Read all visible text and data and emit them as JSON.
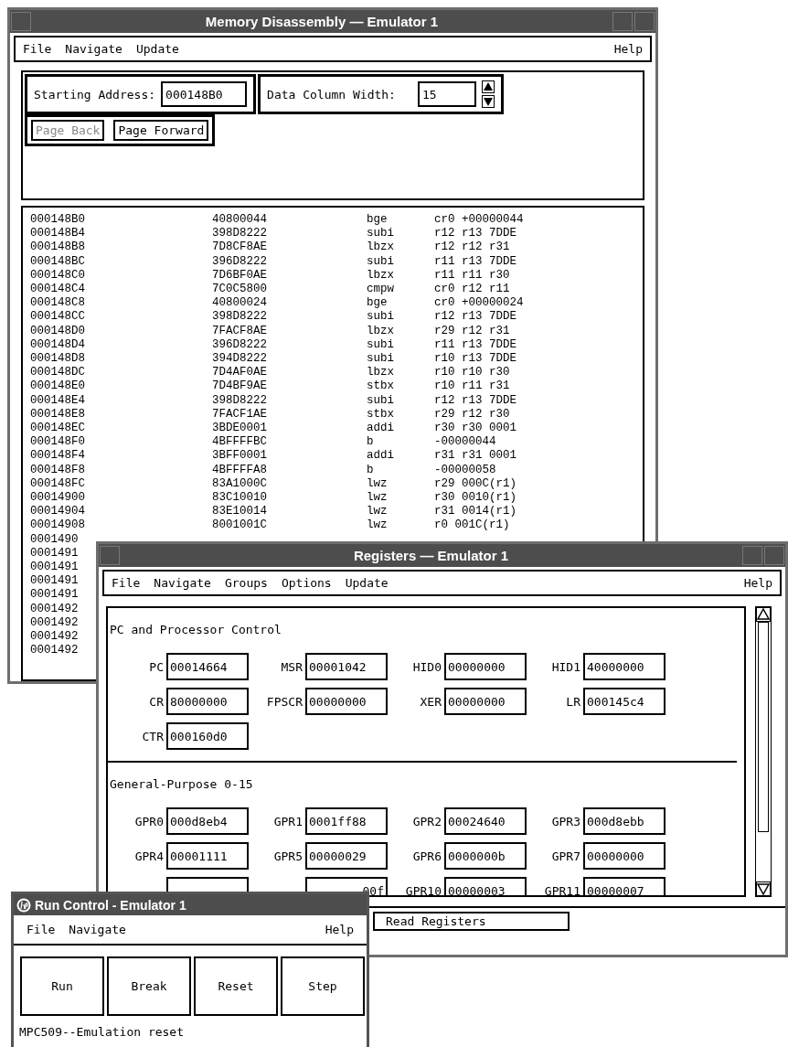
{
  "memory_window": {
    "title": "Memory Disassembly — Emulator 1",
    "menu": [
      "File",
      "Navigate",
      "Update"
    ],
    "help_menu": "Help",
    "starting_address": {
      "label": "Starting Address:",
      "value": "000148B0"
    },
    "data_column_width": {
      "label": "Data Column Width:",
      "value": "15"
    },
    "buttons": [
      {
        "label": "Page Back",
        "disabled": true
      },
      {
        "label": "Page Forward",
        "disabled": false
      }
    ],
    "rows": [
      {
        "address": "000148B0",
        "opcode": "40800044",
        "mnemonic": "bge",
        "operands": "cr0 +00000044"
      },
      {
        "address": "000148B4",
        "opcode": "398D8222",
        "mnemonic": "subi",
        "operands": "r12 r13 7DDE"
      },
      {
        "address": "000148B8",
        "opcode": "7D8CF8AE",
        "mnemonic": "lbzx",
        "operands": "r12 r12 r31"
      },
      {
        "address": "000148BC",
        "opcode": "396D8222",
        "mnemonic": "subi",
        "operands": "r11 r13 7DDE"
      },
      {
        "address": "000148C0",
        "opcode": "7D6BF0AE",
        "mnemonic": "lbzx",
        "operands": "r11 r11 r30"
      },
      {
        "address": "000148C4",
        "opcode": "7C0C5800",
        "mnemonic": "cmpw",
        "operands": "cr0 r12 r11"
      },
      {
        "address": "000148C8",
        "opcode": "40800024",
        "mnemonic": "bge",
        "operands": "cr0 +00000024"
      },
      {
        "address": "000148CC",
        "opcode": "398D8222",
        "mnemonic": "subi",
        "operands": "r12 r13 7DDE"
      },
      {
        "address": "000148D0",
        "opcode": "7FACF8AE",
        "mnemonic": "lbzx",
        "operands": "r29 r12 r31"
      },
      {
        "address": "000148D4",
        "opcode": "396D8222",
        "mnemonic": "subi",
        "operands": "r11 r13 7DDE"
      },
      {
        "address": "000148D8",
        "opcode": "394D8222",
        "mnemonic": "subi",
        "operands": "r10 r13 7DDE"
      },
      {
        "address": "000148DC",
        "opcode": "7D4AF0AE",
        "mnemonic": "lbzx",
        "operands": "r10 r10 r30"
      },
      {
        "address": "000148E0",
        "opcode": "7D4BF9AE",
        "mnemonic": "stbx",
        "operands": "r10 r11 r31"
      },
      {
        "address": "000148E4",
        "opcode": "398D8222",
        "mnemonic": "subi",
        "operands": "r12 r13 7DDE"
      },
      {
        "address": "000148E8",
        "opcode": "7FACF1AE",
        "mnemonic": "stbx",
        "operands": "r29 r12 r30"
      },
      {
        "address": "000148EC",
        "opcode": "3BDE0001",
        "mnemonic": "addi",
        "operands": "r30 r30 0001"
      },
      {
        "address": "000148F0",
        "opcode": "4BFFFFBC",
        "mnemonic": "b",
        "operands": "-00000044"
      },
      {
        "address": "000148F4",
        "opcode": "3BFF0001",
        "mnemonic": "addi",
        "operands": "r31 r31 0001"
      },
      {
        "address": "000148F8",
        "opcode": "4BFFFFA8",
        "mnemonic": "b",
        "operands": "-00000058"
      },
      {
        "address": "000148FC",
        "opcode": "83A1000C",
        "mnemonic": "lwz",
        "operands": "r29 000C(r1)"
      },
      {
        "address": "00014900",
        "opcode": "83C10010",
        "mnemonic": "lwz",
        "operands": "r30 0010(r1)"
      },
      {
        "address": "00014904",
        "opcode": "83E10014",
        "mnemonic": "lwz",
        "operands": "r31 0014(r1)"
      },
      {
        "address": "00014908",
        "opcode": "8001001C",
        "mnemonic": "lwz",
        "operands": "r0 001C(r1)"
      },
      {
        "address": "0001490"
      },
      {
        "address": "0001491"
      },
      {
        "address": "0001491"
      },
      {
        "address": "0001491"
      },
      {
        "address": "0001491"
      },
      {
        "address": "0001492"
      },
      {
        "address": "0001492"
      },
      {
        "address": "0001492"
      },
      {
        "address": "0001492"
      }
    ]
  },
  "registers_window": {
    "title": "Registers — Emulator 1",
    "menu": [
      "File",
      "Navigate",
      "Groups",
      "Options",
      "Update"
    ],
    "help_menu": "Help",
    "groups": [
      {
        "title": "PC and Processor Control",
        "registers": [
          {
            "name": "PC",
            "value": "00014664"
          },
          {
            "name": "MSR",
            "value": "00001042"
          },
          {
            "name": "HID0",
            "value": "00000000"
          },
          {
            "name": "HID1",
            "value": "40000000"
          },
          {
            "name": "CR",
            "value": "80000000"
          },
          {
            "name": "FPSCR",
            "value": "00000000"
          },
          {
            "name": "XER",
            "value": "00000000"
          },
          {
            "name": "LR",
            "value": "000145c4"
          },
          {
            "name": "CTR",
            "value": "000160d0"
          }
        ]
      },
      {
        "title": "General-Purpose 0-15",
        "registers": [
          {
            "name": "GPR0",
            "value": "000d8eb4"
          },
          {
            "name": "GPR1",
            "value": "0001ff88"
          },
          {
            "name": "GPR2",
            "value": "00024640"
          },
          {
            "name": "GPR3",
            "value": "000d8ebb"
          },
          {
            "name": "GPR4",
            "value": "00001111"
          },
          {
            "name": "GPR5",
            "value": "00000029"
          },
          {
            "name": "GPR6",
            "value": "0000000b"
          },
          {
            "name": "GPR7",
            "value": "00000000"
          },
          {
            "kind": "covered"
          },
          {
            "kind": "covered",
            "value": "00f"
          },
          {
            "name": "GPR10",
            "value": "00000003"
          },
          {
            "name": "GPR11",
            "value": "00000007"
          }
        ]
      }
    ],
    "status": "Read Registers"
  },
  "run_control_window": {
    "title": "Run Control - Emulator 1",
    "menu": [
      "File",
      "Navigate"
    ],
    "help_menu": "Help",
    "buttons": [
      "Run",
      "Break",
      "Reset",
      "Step"
    ],
    "status": "MPC509--Emulation reset"
  }
}
